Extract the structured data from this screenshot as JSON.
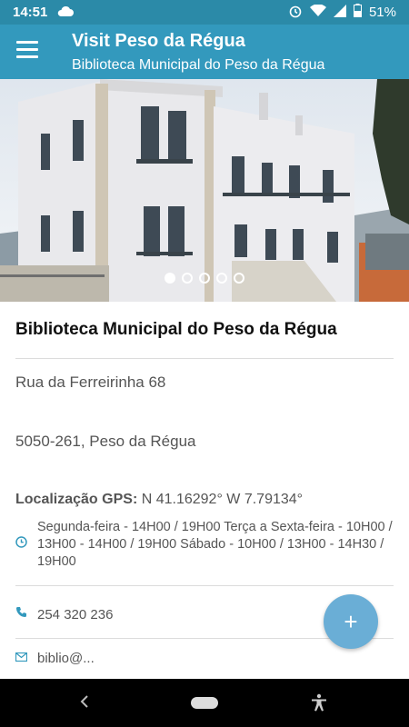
{
  "status": {
    "time": "14:51",
    "battery": "51%"
  },
  "appbar": {
    "title": "Visit Peso da Régua",
    "subtitle": "Biblioteca Municipal do Peso da Régua"
  },
  "carousel": {
    "total": 5,
    "active_index": 0
  },
  "place": {
    "name": "Biblioteca Municipal do Peso da Régua",
    "address_line1": "Rua da Ferreirinha 68",
    "address_line2": "5050-261, Peso da Régua",
    "gps_label": "Localização GPS:",
    "gps_value": " N 41.16292° W 7.79134°",
    "hours": "Segunda-feira - 14H00 / 19H00 Terça a Sexta-feira - 10H00 / 13H00 - 14H00 / 19H00 Sábado - 10H00 / 13H00 - 14H30 / 19H00",
    "phone": "254 320 236",
    "email_partial": "biblio@..."
  },
  "fab": {
    "label": "+"
  },
  "colors": {
    "status_bar": "#2b8aa8",
    "app_bar": "#3399bd",
    "fab": "#6aaed6"
  },
  "icons": {
    "menu": "hamburger-icon",
    "clock": "clock-icon",
    "phone": "phone-icon",
    "email": "email-icon"
  }
}
